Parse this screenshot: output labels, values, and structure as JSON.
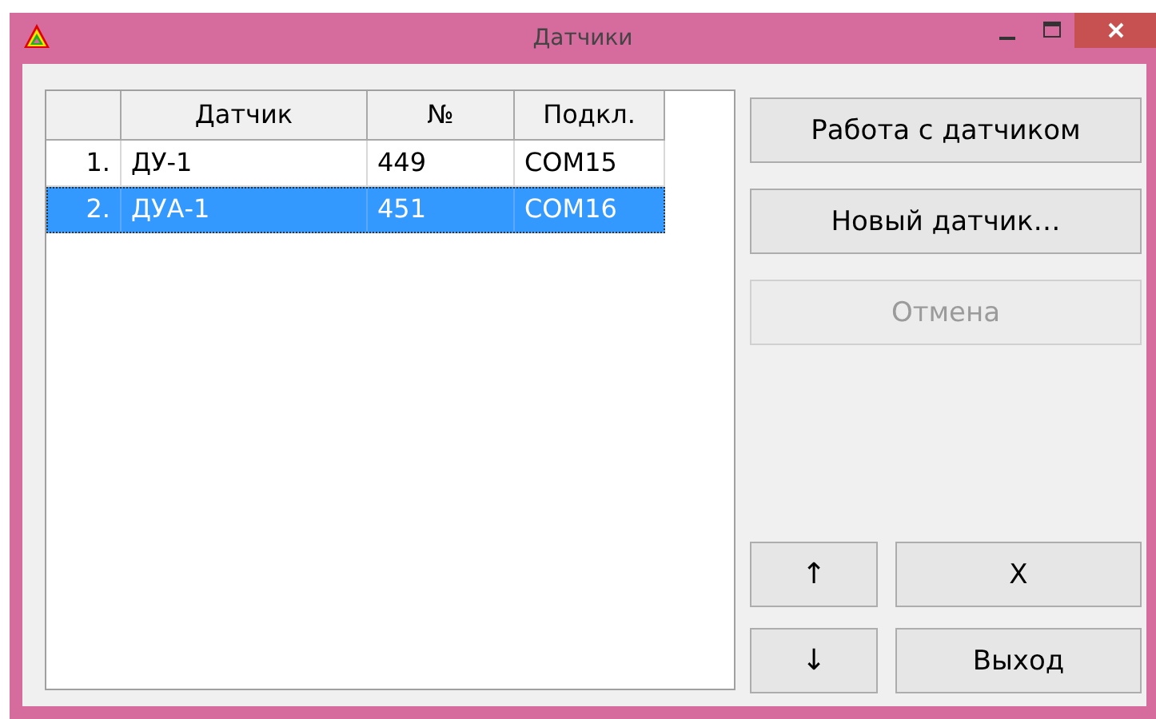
{
  "window": {
    "title": "Датчики"
  },
  "table": {
    "columns": [
      "",
      "Датчик",
      "№",
      "Подкл."
    ],
    "rows": [
      {
        "index": "1.",
        "cells": [
          "ДУ-1",
          "449",
          "COM15"
        ],
        "selected": false
      },
      {
        "index": "2.",
        "cells": [
          "ДУА-1",
          "451",
          "COM16"
        ],
        "selected": true
      }
    ]
  },
  "actions": [
    {
      "label": "Работа с датчиком",
      "disabled": false
    },
    {
      "label": "Новый датчик…",
      "disabled": false
    },
    {
      "label": "Отмена",
      "disabled": true
    }
  ],
  "bottom_buttons": [
    {
      "label": "↑",
      "kind": "small"
    },
    {
      "label": "X",
      "kind": "wide"
    },
    {
      "label": "↓",
      "kind": "small"
    },
    {
      "label": "Выход",
      "kind": "wide"
    }
  ]
}
